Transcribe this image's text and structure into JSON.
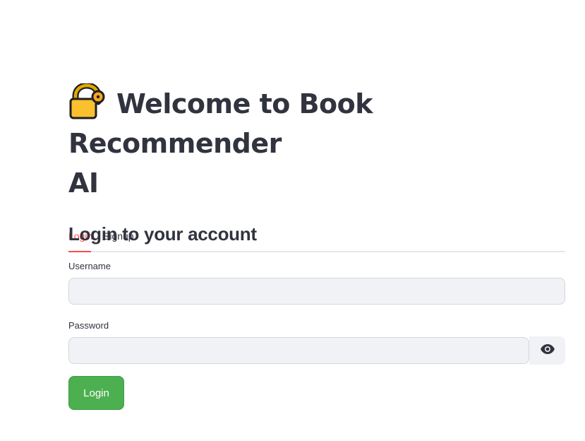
{
  "header": {
    "title_line1": "Welcome to Book Recommender",
    "title_line2": "AI",
    "icon": "lock-icon"
  },
  "tabs": [
    {
      "label": "Login",
      "active": true
    },
    {
      "label": "Signup",
      "active": false
    }
  ],
  "form": {
    "heading": "Login to your account",
    "username": {
      "label": "Username",
      "value": "",
      "placeholder": ""
    },
    "password": {
      "label": "Password",
      "value": "",
      "placeholder": "",
      "toggle_icon": "eye-icon"
    },
    "submit_label": "Login"
  },
  "colors": {
    "accent": "#ff4b4b",
    "button": "#4caf50",
    "input_bg": "#f0f2f6",
    "text": "#31333f"
  }
}
